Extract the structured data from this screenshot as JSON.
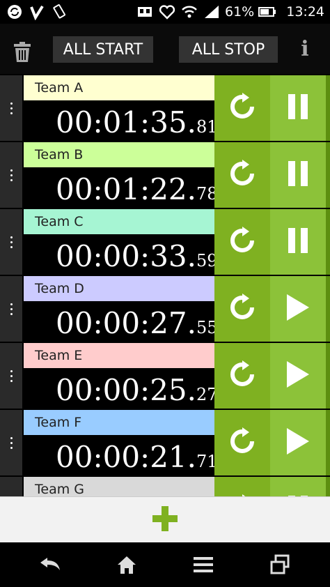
{
  "status_bar": {
    "battery": "61%",
    "time": "13:24",
    "icons": [
      "sync-icon",
      "vine-icon",
      "phone-vibrate-icon",
      "screen-icon",
      "heart-icon",
      "wifi-icon",
      "signal-icon",
      "battery-icon"
    ]
  },
  "toolbar": {
    "all_start": "ALL START",
    "all_stop": "ALL STOP",
    "info": "i"
  },
  "teams": [
    {
      "name": "Team A",
      "time": "00:01:35.",
      "ms": "81",
      "color": "#ffffd0",
      "running": true
    },
    {
      "name": "Team B",
      "time": "00:01:22.",
      "ms": "78",
      "color": "#ccff99",
      "running": true
    },
    {
      "name": "Team C",
      "time": "00:00:33.",
      "ms": "59",
      "color": "#a6f5d3",
      "running": true
    },
    {
      "name": "Team D",
      "time": "00:00:27.",
      "ms": "55",
      "color": "#cccbff",
      "running": false
    },
    {
      "name": "Team E",
      "time": "00:00:25.",
      "ms": "27",
      "color": "#ffcccc",
      "running": false
    },
    {
      "name": "Team F",
      "time": "00:00:21.",
      "ms": "71",
      "color": "#99ccff",
      "running": false
    },
    {
      "name": "Team G",
      "time": "",
      "ms": "",
      "color": "#d9d9d9",
      "running": true
    }
  ],
  "colors": {
    "reset_green": "#7fb121",
    "play_green": "#8cc239",
    "add_green": "#7fb121"
  }
}
